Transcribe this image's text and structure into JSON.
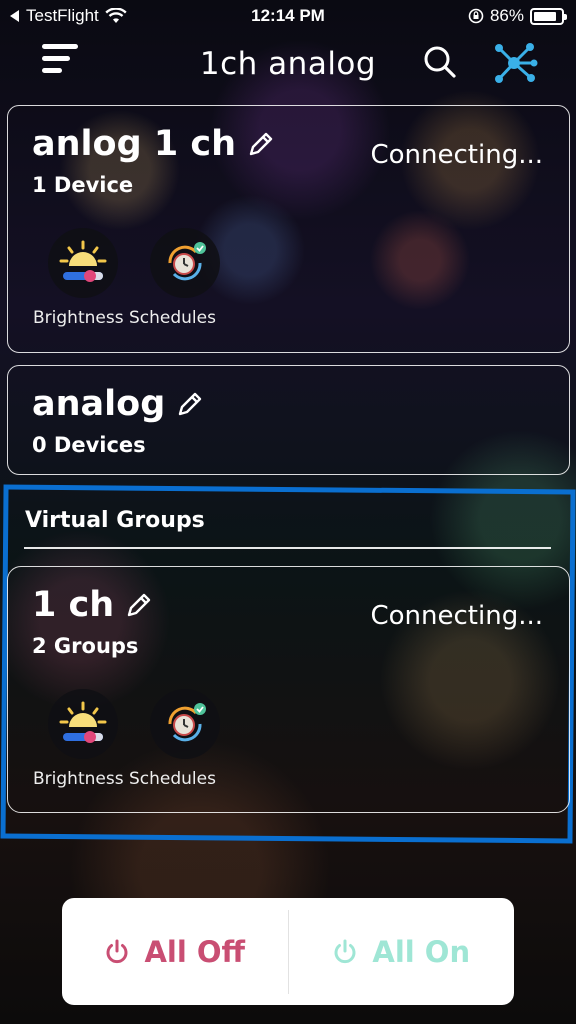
{
  "status_bar": {
    "back_app": "TestFlight",
    "time": "12:14 PM",
    "battery_percent": "86%",
    "battery_level": 0.86
  },
  "header": {
    "title": "1ch analog",
    "icons": [
      "menu-icon",
      "search-icon",
      "network-icon"
    ]
  },
  "groups": [
    {
      "name": "anlog 1 ch",
      "subtitle": "1 Device",
      "status": "Connecting...",
      "features_label": "Brightness Schedules"
    },
    {
      "name": "analog",
      "subtitle": "0 Devices"
    }
  ],
  "virtual_groups": {
    "heading": "Virtual Groups",
    "items": [
      {
        "name": "1 ch",
        "subtitle": "2 Groups",
        "status": "Connecting...",
        "features_label": "Brightness Schedules"
      }
    ]
  },
  "bottom_bar": {
    "all_off_label": "All Off",
    "all_on_label": "All On"
  },
  "colors": {
    "highlight_frame": "#0a6fd0",
    "all_off": "#c94e73",
    "all_on": "#9fe6d5",
    "network_icon": "#3ab0e8"
  }
}
